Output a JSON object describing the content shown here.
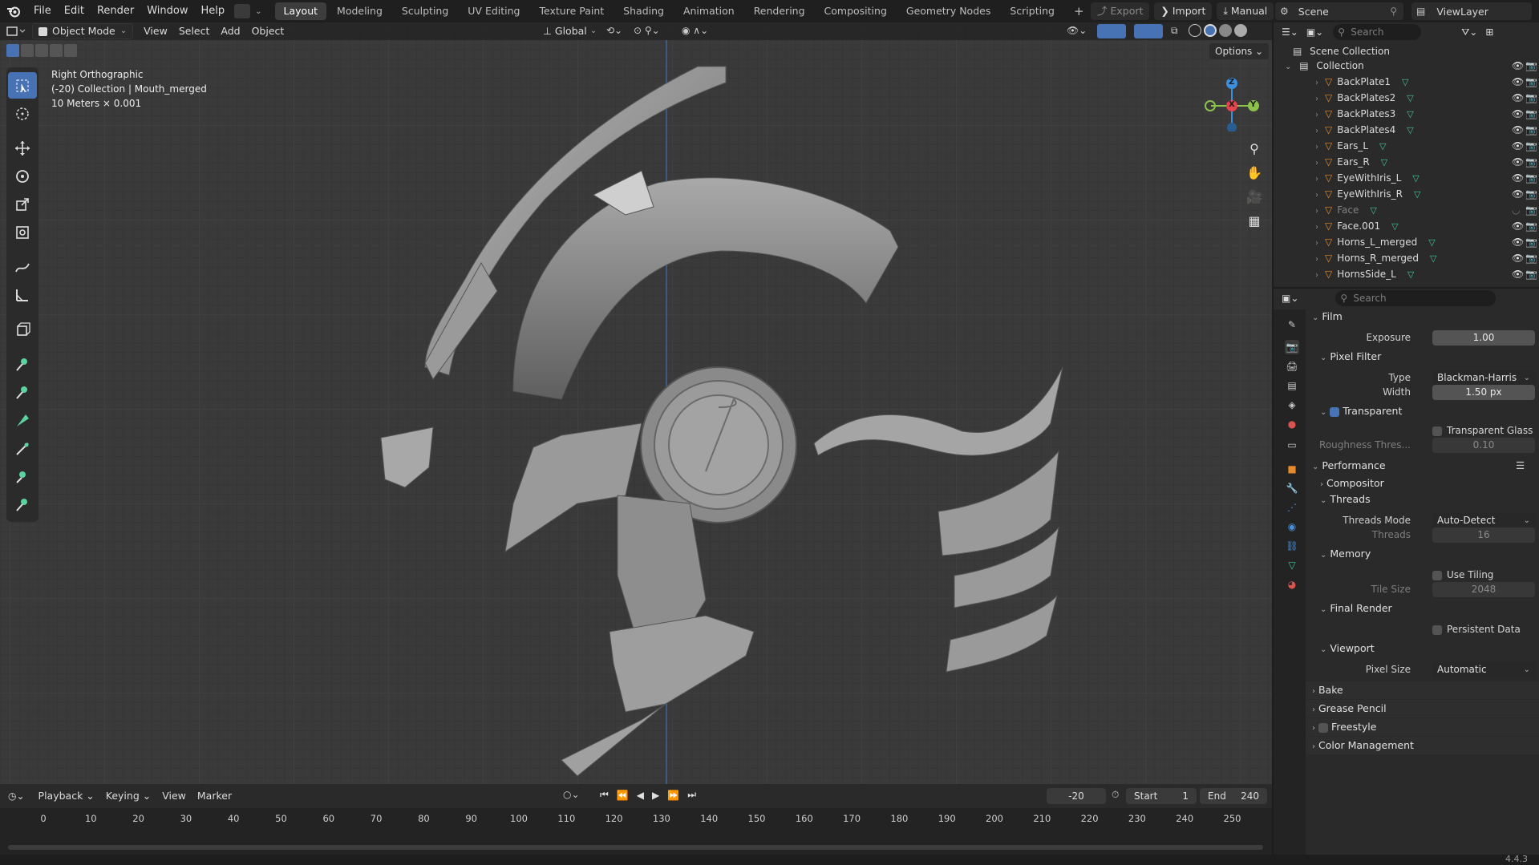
{
  "menu": [
    "File",
    "Edit",
    "Render",
    "Window",
    "Help"
  ],
  "workspaces": [
    "Layout",
    "Modeling",
    "Sculpting",
    "UV Editing",
    "Texture Paint",
    "Shading",
    "Animation",
    "Rendering",
    "Compositing",
    "Geometry Nodes",
    "Scripting"
  ],
  "topbar_right": {
    "export": "Export",
    "import": "Import",
    "manual": "Manual",
    "scene": "Scene",
    "view_layer": "ViewLayer"
  },
  "viewport": {
    "mode": "Object Mode",
    "menus": [
      "View",
      "Select",
      "Add",
      "Object"
    ],
    "orientation": "Global",
    "options": "Options",
    "info": [
      "Right Orthographic",
      "(-20) Collection | Mouth_merged",
      "10 Meters × 0.001"
    ],
    "gizmo": {
      "z": "Z",
      "x": "X",
      "y": "Y"
    }
  },
  "timeline": {
    "menus": [
      "Playback",
      "Keying",
      "View",
      "Marker"
    ],
    "current_frame": "-20",
    "start_label": "Start",
    "start": "1",
    "end_label": "End",
    "end": "240",
    "ticks": [
      "0",
      "10",
      "20",
      "30",
      "40",
      "50",
      "60",
      "70",
      "80",
      "90",
      "100",
      "110",
      "120",
      "130",
      "140",
      "150",
      "160",
      "170",
      "180",
      "190",
      "200",
      "210",
      "220",
      "230",
      "240",
      "250"
    ]
  },
  "outliner": {
    "search_placeholder": "Search",
    "scene_collection": "Scene Collection",
    "collection": "Collection",
    "objects": [
      "BackPlate1",
      "BackPlates2",
      "BackPlates3",
      "BackPlates4",
      "Ears_L",
      "Ears_R",
      "EyeWithIris_L",
      "EyeWithIris_R",
      "Face",
      "Face.001",
      "Horns_L_merged",
      "Horns_R_merged",
      "HornsSide_L"
    ],
    "hidden_objects": [
      "Face"
    ]
  },
  "properties": {
    "search_placeholder": "Search",
    "film": {
      "title": "Film",
      "exposure_label": "Exposure",
      "exposure": "1.00",
      "pixel_filter": "Pixel Filter",
      "type_label": "Type",
      "type": "Blackman-Harris",
      "width_label": "Width",
      "width": "1.50 px",
      "transparent": "Transparent",
      "transparent_glass": "Transparent Glass",
      "roughness_label": "Roughness Thres...",
      "roughness": "0.10"
    },
    "performance": {
      "title": "Performance",
      "compositor": "Compositor",
      "threads": "Threads",
      "threads_mode_label": "Threads Mode",
      "threads_mode": "Auto-Detect",
      "threads_label": "Threads",
      "threads_value": "16",
      "memory": "Memory",
      "use_tiling": "Use Tiling",
      "tile_size_label": "Tile Size",
      "tile_size": "2048",
      "final_render": "Final Render",
      "persistent_data": "Persistent Data",
      "viewport": "Viewport",
      "pixel_size_label": "Pixel Size",
      "pixel_size": "Automatic"
    },
    "collapsed": [
      "Bake",
      "Grease Pencil",
      "Freestyle",
      "Color Management"
    ]
  },
  "version": "4.4.3",
  "colors": {
    "accent": "#4772b3",
    "x_axis": "#e5444f",
    "y_axis": "#8bc34a",
    "z_axis": "#3b8fe0",
    "mesh_icon": "#e58a2a",
    "data_icon": "#41c4a1"
  }
}
